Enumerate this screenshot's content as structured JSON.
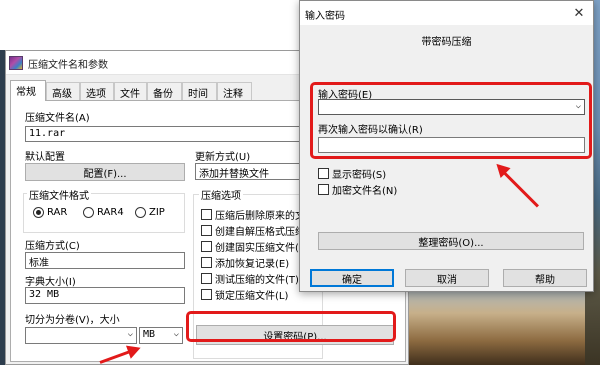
{
  "main_window": {
    "title": "压缩文件名和参数",
    "tabs": [
      {
        "label": "常规",
        "active": true
      },
      {
        "label": "高级"
      },
      {
        "label": "选项"
      },
      {
        "label": "文件"
      },
      {
        "label": "备份"
      },
      {
        "label": "时间"
      },
      {
        "label": "注释"
      }
    ],
    "archive_name_label": "压缩文件名(A)",
    "archive_name_value": "11.rar",
    "default_profile_label": "默认配置",
    "profile_button": "配置(F)...",
    "update_mode_label": "更新方式(U)",
    "update_mode_value": "添加并替换文件",
    "format_group_label": "压缩文件格式",
    "formats": [
      {
        "label": "RAR",
        "selected": true
      },
      {
        "label": "RAR4",
        "selected": false
      },
      {
        "label": "ZIP",
        "selected": false
      }
    ],
    "options_group_label": "压缩选项",
    "options": [
      {
        "label": "压缩后删除原来的文",
        "checked": false
      },
      {
        "label": "创建自解压格式压缩",
        "checked": false
      },
      {
        "label": "创建固实压缩文件(",
        "checked": false
      },
      {
        "label": "添加恢复记录(E)",
        "checked": false
      },
      {
        "label": "测试压缩的文件(T)",
        "checked": false
      },
      {
        "label": "锁定压缩文件(L)",
        "checked": false
      }
    ],
    "method_label": "压缩方式(C)",
    "method_value": "标准",
    "dict_label": "字典大小(I)",
    "dict_value": "32 MB",
    "split_label": "切分为分卷(V)，大小",
    "split_value": "",
    "split_unit": "MB",
    "set_password_button": "设置密码(P)..."
  },
  "password_dialog": {
    "title": "输入密码",
    "close_glyph": "✕",
    "subtitle": "带密码压缩",
    "enter_label": "输入密码(E)",
    "enter_value": "",
    "reenter_label": "再次输入密码以确认(R)",
    "reenter_value": "",
    "show_password_label": "显示密码(S)",
    "encrypt_names_label": "加密文件名(N)",
    "organize_button": "整理密码(O)...",
    "ok_button": "确定",
    "cancel_button": "取消",
    "help_button": "帮助"
  },
  "colors": {
    "annotation_red": "#e21a1a",
    "dialog_bg": "#f0f0f0",
    "button_bg": "#e1e1e1",
    "ok_border": "#0078d7"
  },
  "icons": {
    "app": "winrar-icon",
    "dropdown": "chevron-down-icon",
    "close": "close-icon"
  }
}
